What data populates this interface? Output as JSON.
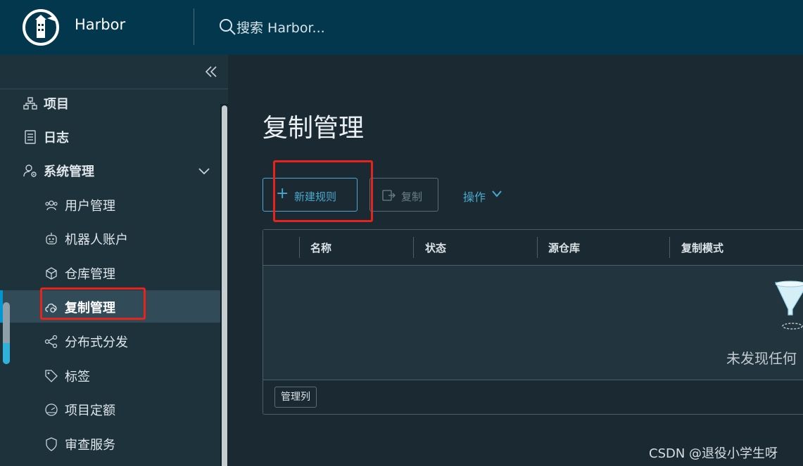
{
  "header": {
    "app_title": "Harbor",
    "search_placeholder": "搜索 Harbor...",
    "logo_icon": "lighthouse-logo",
    "search_icon": "search-icon"
  },
  "sidebar": {
    "collapse_icon": "double-chevron-left-icon",
    "items": [
      {
        "label": "项目",
        "icon": "projects-icon",
        "level": "top"
      },
      {
        "label": "日志",
        "icon": "logs-icon",
        "level": "top"
      },
      {
        "label": "系统管理",
        "icon": "user-gear-icon",
        "level": "top",
        "expanded": true
      },
      {
        "label": "用户管理",
        "icon": "users-icon",
        "level": "sub"
      },
      {
        "label": "机器人账户",
        "icon": "robot-icon",
        "level": "sub"
      },
      {
        "label": "仓库管理",
        "icon": "cube-icon",
        "level": "sub"
      },
      {
        "label": "复制管理",
        "icon": "cloud-sync-icon",
        "level": "sub",
        "active": true
      },
      {
        "label": "分布式分发",
        "icon": "share-icon",
        "level": "sub"
      },
      {
        "label": "标签",
        "icon": "tag-icon",
        "level": "sub"
      },
      {
        "label": "项目定额",
        "icon": "gauge-icon",
        "level": "sub"
      },
      {
        "label": "审查服务",
        "icon": "shield-icon",
        "level": "sub"
      }
    ]
  },
  "main": {
    "page_title": "复制管理",
    "new_rule_button": "新建规则",
    "copy_button": "复制",
    "actions_dropdown": "操作",
    "table": {
      "columns": [
        "名称",
        "状态",
        "源仓库",
        "复制模式"
      ],
      "rows": [],
      "empty_text": "未发现任何",
      "manage_columns_button": "管理列"
    }
  },
  "watermark": "CSDN @退役小学生呀",
  "colors": {
    "header_bg": "#02374d",
    "sidebar_bg": "#1e323c",
    "main_bg": "#1b2a32",
    "accent": "#49a9cf",
    "annotation_red": "#e8231b"
  }
}
